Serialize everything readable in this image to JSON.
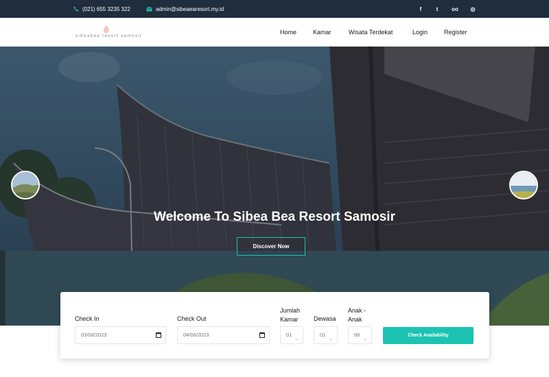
{
  "topbar": {
    "phone": "(021) 655 3235 322",
    "email": "admin@sibeaearesort.my.id",
    "social": [
      {
        "name": "facebook-icon",
        "glyph": "f"
      },
      {
        "name": "twitter-icon",
        "glyph": "t"
      },
      {
        "name": "tripadvisor-icon",
        "glyph": "oo"
      },
      {
        "name": "instagram-icon",
        "glyph": "◎"
      }
    ]
  },
  "header": {
    "logo_text": "sibeabea resort samosir",
    "nav": [
      "Home",
      "Kamar",
      "Wisata Terdekat",
      "Login",
      "Register"
    ]
  },
  "hero": {
    "title": "Welcome To Sibea Bea Resort Samosir",
    "button": "Discover Now"
  },
  "booking": {
    "check_in_label": "Check In",
    "check_in_value": "03/06/2023",
    "check_out_label": "Check Out",
    "check_out_value": "04/06/2023",
    "rooms_label_1": "Jumlah",
    "rooms_label_2": "Kamar",
    "rooms_value": "01",
    "adults_label": "Dewasa",
    "adults_value": "01",
    "children_label_1": "Anak -",
    "children_label_2": "Anak",
    "children_value": "00",
    "submit": "Check Availability"
  },
  "colors": {
    "accent": "#1cc3b2",
    "topbar": "#1f2d3d"
  }
}
